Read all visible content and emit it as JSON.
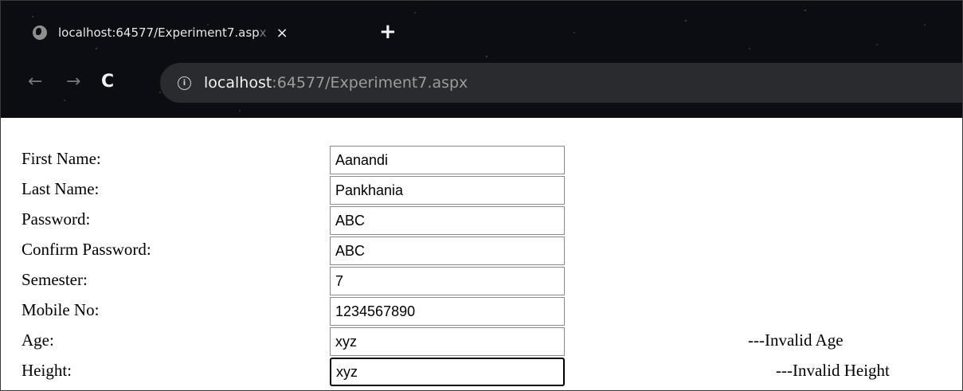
{
  "browser": {
    "tab_title": "localhost:64577/Experiment7.asp",
    "tab_title_fade": "x",
    "close_glyph": "×",
    "new_tab_glyph": "+",
    "back_glyph": "←",
    "forward_glyph": "→",
    "reload_glyph": "C",
    "info_glyph": "i",
    "url_host": "localhost",
    "url_rest": ":64577/Experiment7.aspx"
  },
  "form": {
    "rows": [
      {
        "label": "First Name:",
        "value": "Aanandi"
      },
      {
        "label": "Last Name:",
        "value": "Pankhania"
      },
      {
        "label": "Password:",
        "value": "ABC"
      },
      {
        "label": "Confirm Password:",
        "value": "ABC"
      },
      {
        "label": "Semester:",
        "value": "7"
      },
      {
        "label": "Mobile No:",
        "value": "1234567890"
      },
      {
        "label": "Age:",
        "value": "xyz",
        "error": "---Invalid Age"
      },
      {
        "label": "Height:",
        "value": "xyz",
        "error": "---Invalid Height"
      }
    ]
  },
  "icons": {
    "tab_favicon": "globe-icon",
    "security": "info-icon"
  }
}
